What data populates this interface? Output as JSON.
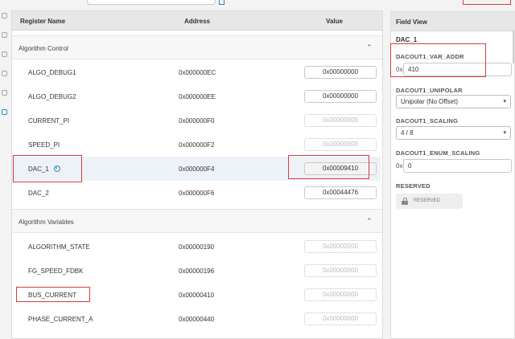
{
  "table": {
    "headers": {
      "name": "Register Name",
      "address": "Address",
      "value": "Value"
    },
    "groups": [
      {
        "title": "Algorithm Control",
        "rows": [
          {
            "name": "ALGO_DEBUG1",
            "address": "0x000000EC",
            "value": "0x00000000",
            "editable": true
          },
          {
            "name": "ALGO_DEBUG2",
            "address": "0x000000EE",
            "value": "0x00000000",
            "editable": true
          },
          {
            "name": "CURRENT_PI",
            "address": "0x000000F0",
            "value": "0x00000000",
            "editable": false
          },
          {
            "name": "SPEED_PI",
            "address": "0x000000F2",
            "value": "0x00000000",
            "editable": false
          },
          {
            "name": "DAC_1",
            "address": "0x000000F4",
            "value": "0x00009410",
            "editable": false,
            "selected": true
          },
          {
            "name": "DAC_2",
            "address": "0x000000F6",
            "value": "0x00044476",
            "editable": true
          }
        ]
      },
      {
        "title": "Algorithm Variables",
        "rows": [
          {
            "name": "ALGORITHM_STATE",
            "address": "0x00000190",
            "value": "0x00000000",
            "editable": false
          },
          {
            "name": "FG_SPEED_FDBK",
            "address": "0x00000196",
            "value": "0x00000000",
            "editable": false
          },
          {
            "name": "BUS_CURRENT",
            "address": "0x00000410",
            "value": "0x00000000",
            "editable": false
          },
          {
            "name": "PHASE_CURRENT_A",
            "address": "0x00000440",
            "value": "0x00000000",
            "editable": false
          }
        ]
      }
    ]
  },
  "field_view": {
    "title": "Field View",
    "register": "DAC_1",
    "fields": {
      "var_addr": {
        "label": "DACOUT1_VAR_ADDR",
        "prefix": "0x",
        "value": "410"
      },
      "unipolar": {
        "label": "DACOUT1_UNIPOLAR",
        "value": "Unipolar (No Offset)"
      },
      "scaling": {
        "label": "DACOUT1_SCALING",
        "value": "4 / 8"
      },
      "enum_scaling": {
        "label": "DACOUT1_ENUM_SCALING",
        "prefix": "0x",
        "value": "0"
      },
      "reserved": {
        "label": "RESERVED",
        "value": "RESERVED"
      }
    }
  },
  "colors": {
    "highlight": "#d83b3b",
    "accent": "#2a8fbd",
    "selected_row": "#edf2f8"
  },
  "icons": {
    "group_toggle": "chevron-up-icon",
    "select": "chevron-down-icon",
    "info": "info-icon",
    "reserved": "lock-icon"
  }
}
